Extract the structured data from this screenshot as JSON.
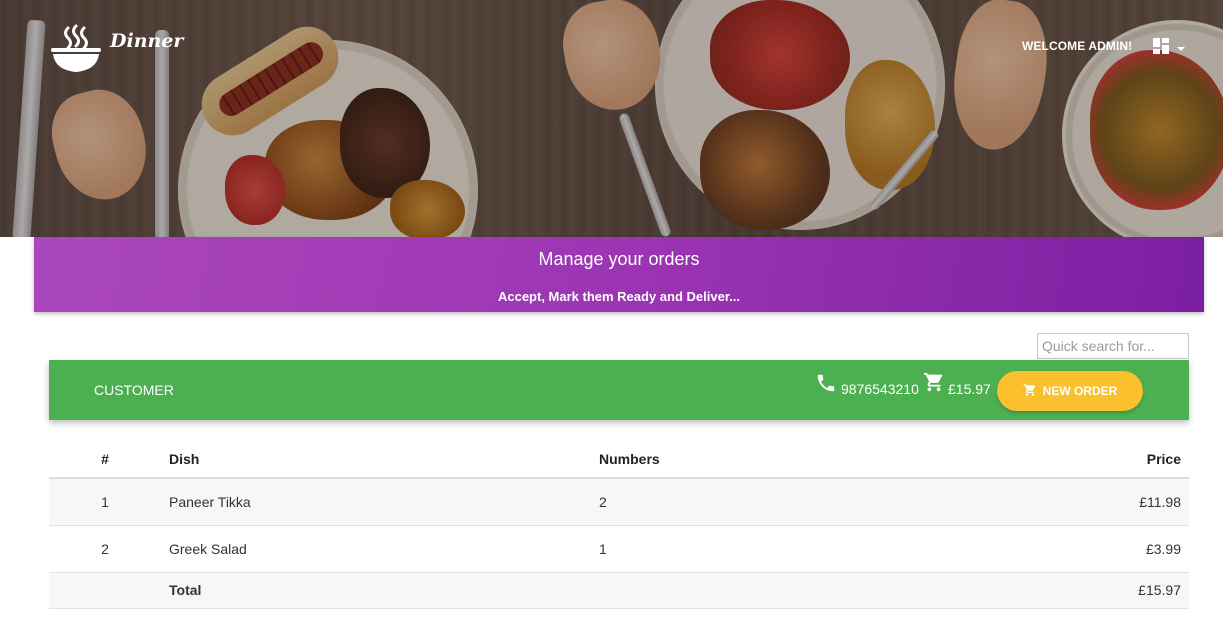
{
  "app": {
    "brand": "Dinner",
    "welcome": "WELCOME ADMIN!"
  },
  "icons": {
    "brand": "bowl-icon",
    "menu": "dashboard-icon",
    "dropdown": "caret-down-icon",
    "phone": "phone-icon",
    "cart": "cart-icon"
  },
  "banner": {
    "title": "Manage your orders",
    "subtitle": "Accept, Mark them Ready and Deliver..."
  },
  "search": {
    "placeholder": "Quick search for..."
  },
  "customer_bar": {
    "label": "CUSTOMER",
    "phone": "9876543210",
    "cart_total": "£15.97",
    "new_order_label": "NEW ORDER"
  },
  "colors": {
    "banner_start": "#ab47bc",
    "banner_end": "#7b1fa2",
    "customer_bar": "#4caf50",
    "new_order_button": "#fbc02d"
  },
  "table": {
    "headers": {
      "num": "#",
      "dish": "Dish",
      "numbers": "Numbers",
      "price": "Price"
    },
    "rows": [
      {
        "num": "1",
        "dish": "Paneer Tikka",
        "numbers": "2",
        "price": "£11.98"
      },
      {
        "num": "2",
        "dish": "Greek Salad",
        "numbers": "1",
        "price": "£3.99"
      }
    ],
    "total": {
      "label": "Total",
      "price": "£15.97"
    }
  }
}
